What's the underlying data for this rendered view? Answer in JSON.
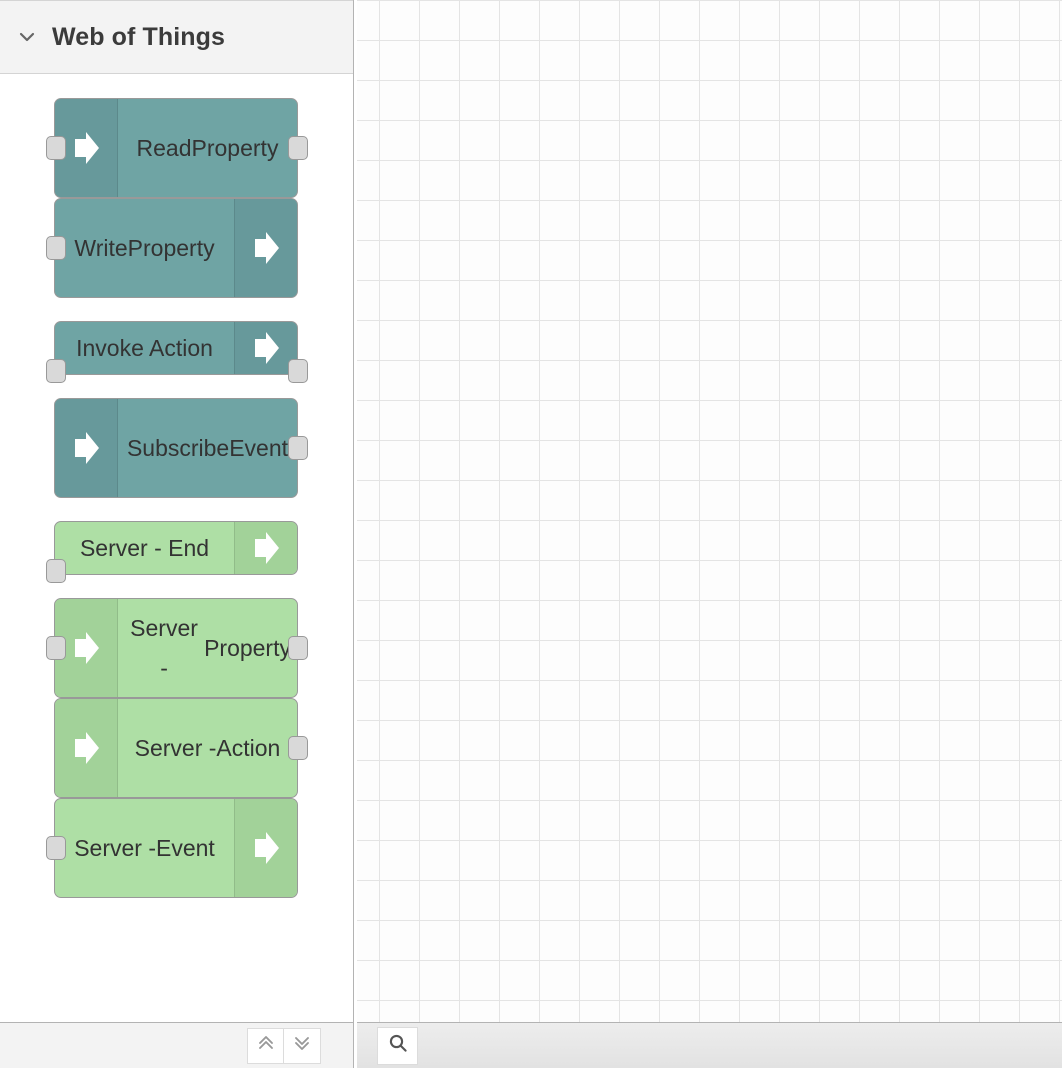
{
  "palette": {
    "category": {
      "title": "Web of Things",
      "expanded": true,
      "chevron_icon": "chevron-down-icon"
    },
    "nodes": [
      {
        "label": "Read Property",
        "label_lines": [
          "Read",
          "Property"
        ],
        "color": "teal",
        "icon": "arrow-right-icon",
        "icon_side": "left",
        "has_input": true,
        "has_output": true,
        "size": "tall"
      },
      {
        "label": "Write Property",
        "label_lines": [
          "Write",
          "Property"
        ],
        "color": "teal",
        "icon": "arrow-right-icon",
        "icon_side": "right",
        "has_input": true,
        "has_output": false,
        "size": "tall"
      },
      {
        "label": "Invoke Action",
        "label_lines": [
          "Invoke Action"
        ],
        "color": "teal",
        "icon": "arrow-right-icon",
        "icon_side": "right",
        "has_input": true,
        "has_output": true,
        "size": "short"
      },
      {
        "label": "Subscribe Event",
        "label_lines": [
          "Subscribe",
          "Event"
        ],
        "color": "teal",
        "icon": "arrow-right-icon",
        "icon_side": "left",
        "has_input": false,
        "has_output": true,
        "size": "tall"
      },
      {
        "label": "Server - End",
        "label_lines": [
          "Server - End"
        ],
        "color": "green",
        "icon": "arrow-right-icon",
        "icon_side": "right",
        "has_input": true,
        "has_output": false,
        "size": "short"
      },
      {
        "label": "Server - Property",
        "label_lines": [
          "Server -",
          "Property"
        ],
        "color": "green",
        "icon": "arrow-right-icon",
        "icon_side": "left",
        "has_input": true,
        "has_output": true,
        "size": "tall"
      },
      {
        "label": "Server - Action",
        "label_lines": [
          "Server -",
          "Action"
        ],
        "color": "green",
        "icon": "arrow-right-icon",
        "icon_side": "left",
        "has_input": false,
        "has_output": true,
        "size": "tall"
      },
      {
        "label": "Server - Event",
        "label_lines": [
          "Server -",
          "Event"
        ],
        "color": "green",
        "icon": "arrow-right-icon",
        "icon_side": "right",
        "has_input": true,
        "has_output": false,
        "size": "tall"
      }
    ],
    "footer": {
      "collapse_all_icon": "double-chevron-up-icon",
      "expand_all_icon": "double-chevron-down-icon"
    }
  },
  "bottom_bar": {
    "search_icon": "search-icon"
  },
  "colors": {
    "node_teal_body": "#6fa4a4",
    "node_teal_icon": "#67999b",
    "node_green_body": "#aedfa5",
    "node_green_icon": "#a2d299",
    "node_border": "#999999",
    "port_fill": "#d9d9d9",
    "panel_header_bg": "#f3f3f3",
    "canvas_grid": "#e4e4e4",
    "text": "#333333"
  }
}
